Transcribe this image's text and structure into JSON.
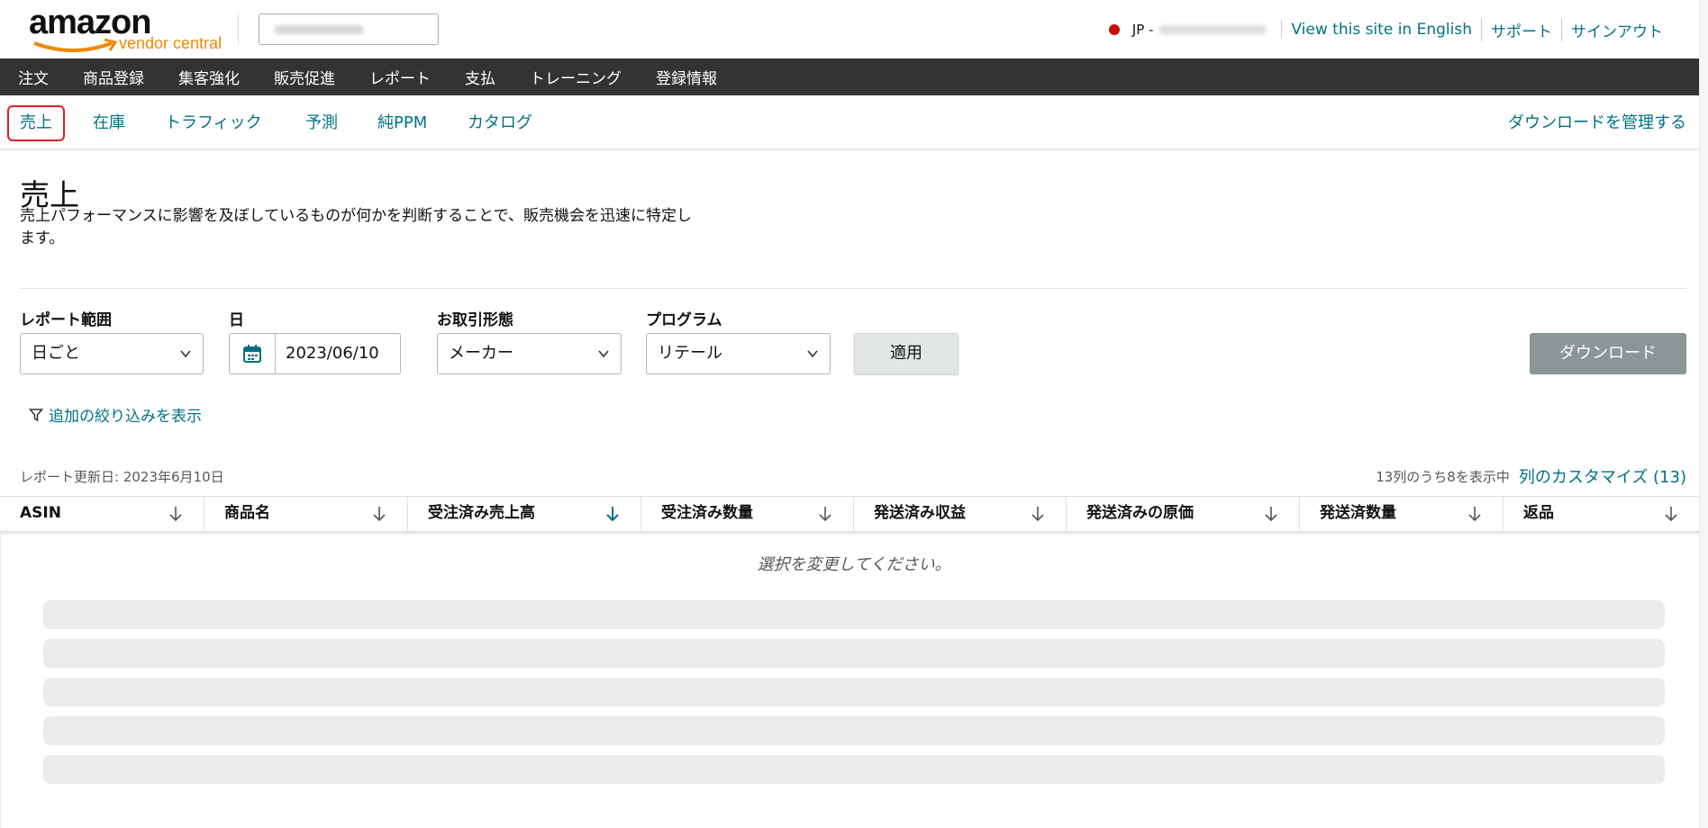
{
  "header": {
    "logo_word": "amazon",
    "logo_sub": "vendor central",
    "region": "JP -",
    "links": [
      "View this site in English",
      "サポート",
      "サインアウト"
    ]
  },
  "nav": [
    "注文",
    "商品登録",
    "集客強化",
    "販売促進",
    "レポート",
    "支払",
    "トレーニング",
    "登録情報"
  ],
  "subnav": {
    "tabs": [
      "売上",
      "在庫",
      "トラフィック",
      "予測",
      "純PPM",
      "カタログ"
    ],
    "active": "売上",
    "manage": "ダウンロードを管理する"
  },
  "page": {
    "title": "売上",
    "description": "売上パフォーマンスに影響を及ぼしているものが何かを判断することで、販売機会を迅速に特定します。"
  },
  "filters": {
    "range_label": "レポート範囲",
    "range_value": "日ごと",
    "day_label": "日",
    "day_value": "2023/06/10",
    "type_label": "お取引形態",
    "type_value": "メーカー",
    "program_label": "プログラム",
    "program_value": "リテール",
    "apply": "適用",
    "download": "ダウンロード",
    "more": "追加の絞り込みを表示"
  },
  "table": {
    "updated": "レポート更新日: 2023年6月10日",
    "shown": "13列のうち8を表示中",
    "customize": "列のカスタマイズ (13)",
    "columns": [
      "ASIN",
      "商品名",
      "受注済み売上高",
      "受注済み数量",
      "発送済み収益",
      "発送済みの原価",
      "発送済数量",
      "返品"
    ],
    "empty": "選択を変更してください。"
  },
  "colors": {
    "link": "#007185",
    "nav_bg": "#333333",
    "active_border": "#e02020",
    "download_btn": "#8d9696"
  }
}
